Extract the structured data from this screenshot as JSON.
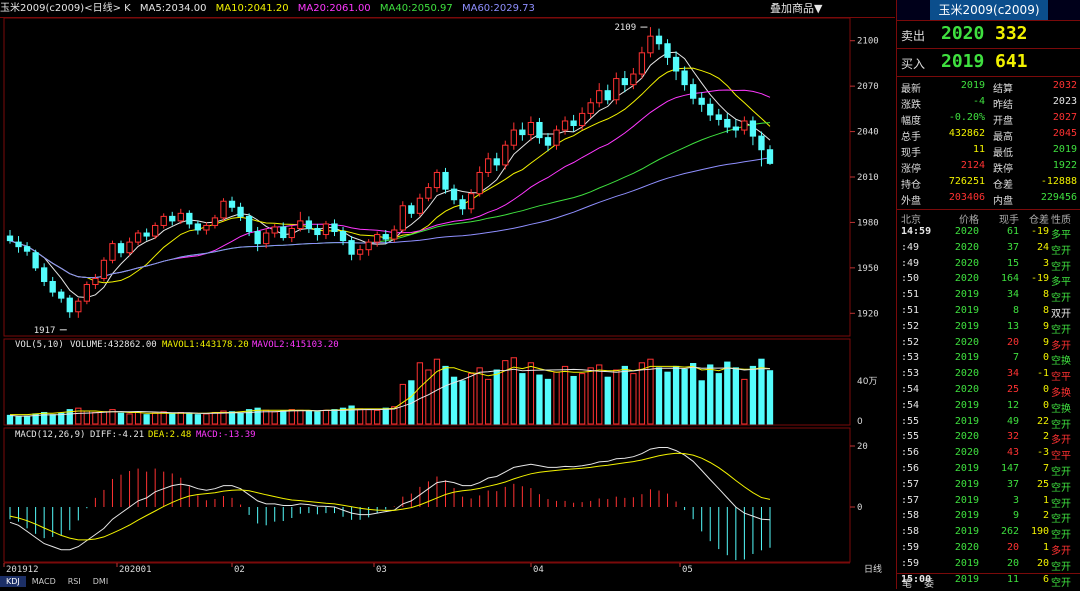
{
  "header": {
    "title": "玉米2009(c2009)<日线> K",
    "ma5": "MA5:2034.00",
    "ma10": "MA10:2041.20",
    "ma20": "MA20:2061.00",
    "ma40": "MA40:2050.97",
    "ma60": "MA60:2029.73",
    "add_label": "叠加商品▼"
  },
  "vol_header": {
    "label": "VOL(5,10)",
    "volume": "VOLUME:432862.00",
    "mavol1": "MAVOL1:443178.20",
    "mavol2": "MAVOL2:415103.20"
  },
  "macd_header": {
    "label": "MACD(12,26,9)",
    "diff": "DIFF:-4.21",
    "dea": "DEA:2.48",
    "macd": "MACD:-13.39"
  },
  "indicator_tabs": [
    "KDJ",
    "MACD",
    "RSI",
    "DMI"
  ],
  "colors": {
    "up": "#ff3232",
    "down": "#54fcfc",
    "ma5": "#e6e6e6",
    "ma10": "#f2f200",
    "ma20": "#ff38ff",
    "ma40": "#3fe03f",
    "ma60": "#8f8fff",
    "grid": "#7a0a0a"
  },
  "chart_data": {
    "type": "candlestick",
    "price_axis": {
      "ticks": [
        1920,
        1950,
        1980,
        2010,
        2040,
        2070,
        2100
      ],
      "range": [
        1905,
        2115
      ]
    },
    "annotations": [
      {
        "text": "2109",
        "value": 2109
      },
      {
        "text": "1917",
        "value": 1917
      }
    ],
    "date_labels": [
      "201912",
      "202001",
      "02",
      "03",
      "04",
      "05"
    ],
    "period_label": "日线",
    "volume_axis": {
      "ticks": [
        "40万",
        "0"
      ]
    },
    "macd_axis": {
      "ticks": [
        20,
        0
      ]
    },
    "candles": [
      [
        1971,
        1968,
        1975,
        1966
      ],
      [
        1967,
        1964,
        1971,
        1960
      ],
      [
        1964,
        1961,
        1967,
        1958
      ],
      [
        1960,
        1950,
        1962,
        1948
      ],
      [
        1950,
        1941,
        1953,
        1938
      ],
      [
        1941,
        1934,
        1944,
        1931
      ],
      [
        1934,
        1930,
        1936,
        1927
      ],
      [
        1930,
        1921,
        1932,
        1917
      ],
      [
        1921,
        1928,
        1930,
        1917
      ],
      [
        1928,
        1939,
        1941,
        1926
      ],
      [
        1939,
        1943,
        1946,
        1936
      ],
      [
        1943,
        1955,
        1957,
        1941
      ],
      [
        1955,
        1966,
        1968,
        1953
      ],
      [
        1966,
        1960,
        1968,
        1957
      ],
      [
        1960,
        1967,
        1970,
        1958
      ],
      [
        1967,
        1973,
        1975,
        1965
      ],
      [
        1973,
        1971,
        1976,
        1968
      ],
      [
        1971,
        1978,
        1980,
        1969
      ],
      [
        1978,
        1984,
        1986,
        1976
      ],
      [
        1984,
        1981,
        1987,
        1978
      ],
      [
        1981,
        1986,
        1989,
        1979
      ],
      [
        1986,
        1979,
        1988,
        1976
      ],
      [
        1979,
        1975,
        1981,
        1972
      ],
      [
        1975,
        1978,
        1980,
        1972
      ],
      [
        1978,
        1983,
        1985,
        1976
      ],
      [
        1983,
        1994,
        1996,
        1981
      ],
      [
        1994,
        1990,
        1997,
        1987
      ],
      [
        1990,
        1984,
        1993,
        1981
      ],
      [
        1984,
        1974,
        1986,
        1971
      ],
      [
        1974,
        1966,
        1977,
        1961
      ],
      [
        1966,
        1973,
        1976,
        1963
      ],
      [
        1973,
        1977,
        1979,
        1970
      ],
      [
        1977,
        1970,
        1980,
        1968
      ],
      [
        1970,
        1976,
        1978,
        1967
      ],
      [
        1976,
        1981,
        1987,
        1974
      ],
      [
        1981,
        1976,
        1984,
        1973
      ],
      [
        1976,
        1972,
        1979,
        1968
      ],
      [
        1972,
        1979,
        1981,
        1969
      ],
      [
        1979,
        1974,
        1982,
        1971
      ],
      [
        1974,
        1968,
        1977,
        1965
      ],
      [
        1968,
        1959,
        1971,
        1955
      ],
      [
        1959,
        1962,
        1965,
        1955
      ],
      [
        1962,
        1967,
        1969,
        1958
      ],
      [
        1967,
        1972,
        1974,
        1964
      ],
      [
        1972,
        1969,
        1975,
        1966
      ],
      [
        1969,
        1975,
        1978,
        1967
      ],
      [
        1975,
        1991,
        1994,
        1973
      ],
      [
        1991,
        1986,
        1993,
        1983
      ],
      [
        1986,
        1996,
        1999,
        1984
      ],
      [
        1996,
        2003,
        2006,
        1994
      ],
      [
        2003,
        2013,
        2015,
        2000
      ],
      [
        2013,
        2002,
        2016,
        1999
      ],
      [
        2002,
        1995,
        2005,
        1992
      ],
      [
        1995,
        1989,
        1998,
        1985
      ],
      [
        1989,
        1999,
        2002,
        1986
      ],
      [
        1999,
        2013,
        2017,
        1997
      ],
      [
        2013,
        2022,
        2026,
        2010
      ],
      [
        2022,
        2018,
        2026,
        2014
      ],
      [
        2018,
        2031,
        2034,
        2015
      ],
      [
        2031,
        2041,
        2046,
        2028
      ],
      [
        2041,
        2038,
        2046,
        2034
      ],
      [
        2038,
        2046,
        2050,
        2034
      ],
      [
        2046,
        2036,
        2049,
        2032
      ],
      [
        2036,
        2031,
        2039,
        2027
      ],
      [
        2031,
        2041,
        2044,
        2028
      ],
      [
        2041,
        2047,
        2050,
        2038
      ],
      [
        2047,
        2044,
        2051,
        2040
      ],
      [
        2044,
        2052,
        2056,
        2041
      ],
      [
        2052,
        2059,
        2062,
        2049
      ],
      [
        2059,
        2067,
        2072,
        2056
      ],
      [
        2067,
        2061,
        2071,
        2058
      ],
      [
        2061,
        2075,
        2079,
        2058
      ],
      [
        2075,
        2071,
        2080,
        2066
      ],
      [
        2071,
        2078,
        2082,
        2068
      ],
      [
        2078,
        2092,
        2096,
        2075
      ],
      [
        2092,
        2103,
        2109,
        2089
      ],
      [
        2103,
        2098,
        2108,
        2094
      ],
      [
        2098,
        2089,
        2101,
        2084
      ],
      [
        2089,
        2080,
        2093,
        2074
      ],
      [
        2080,
        2071,
        2083,
        2067
      ],
      [
        2071,
        2062,
        2075,
        2058
      ],
      [
        2062,
        2058,
        2066,
        2053
      ],
      [
        2058,
        2051,
        2062,
        2047
      ],
      [
        2051,
        2048,
        2055,
        2044
      ],
      [
        2048,
        2043,
        2052,
        2039
      ],
      [
        2043,
        2041,
        2048,
        2036
      ],
      [
        2041,
        2047,
        2050,
        2038
      ],
      [
        2047,
        2037,
        2050,
        2031
      ],
      [
        2037,
        2028,
        2040,
        2017
      ],
      [
        2028,
        2019,
        2031,
        2018
      ]
    ],
    "volume_levels": [
      0.12,
      0.1,
      0.11,
      0.14,
      0.16,
      0.13,
      0.15,
      0.2,
      0.22,
      0.18,
      0.16,
      0.17,
      0.2,
      0.15,
      0.14,
      0.16,
      0.13,
      0.15,
      0.17,
      0.14,
      0.16,
      0.15,
      0.13,
      0.14,
      0.16,
      0.18,
      0.17,
      0.15,
      0.2,
      0.22,
      0.19,
      0.17,
      0.18,
      0.2,
      0.19,
      0.18,
      0.17,
      0.19,
      0.2,
      0.22,
      0.25,
      0.21,
      0.2,
      0.19,
      0.22,
      0.24,
      0.55,
      0.6,
      0.85,
      0.75,
      0.9,
      0.8,
      0.65,
      0.6,
      0.7,
      0.78,
      0.62,
      0.75,
      0.88,
      0.92,
      0.7,
      0.85,
      0.68,
      0.62,
      0.72,
      0.8,
      0.66,
      0.7,
      0.78,
      0.82,
      0.65,
      0.75,
      0.8,
      0.7,
      0.85,
      0.9,
      0.78,
      0.72,
      0.8,
      0.76,
      0.84,
      0.6,
      0.82,
      0.7,
      0.86,
      0.78,
      0.62,
      0.8,
      0.9,
      0.74
    ],
    "mavol1": [
      0.13,
      0.13,
      0.13,
      0.14,
      0.15,
      0.15,
      0.16,
      0.17,
      0.18,
      0.18,
      0.18,
      0.17,
      0.17,
      0.17,
      0.16,
      0.16,
      0.15,
      0.15,
      0.15,
      0.15,
      0.15,
      0.15,
      0.15,
      0.15,
      0.16,
      0.16,
      0.16,
      0.17,
      0.18,
      0.19,
      0.19,
      0.19,
      0.19,
      0.19,
      0.19,
      0.19,
      0.18,
      0.19,
      0.19,
      0.2,
      0.21,
      0.21,
      0.21,
      0.21,
      0.21,
      0.22,
      0.3,
      0.38,
      0.51,
      0.62,
      0.73,
      0.78,
      0.78,
      0.74,
      0.71,
      0.7,
      0.67,
      0.69,
      0.74,
      0.79,
      0.77,
      0.8,
      0.77,
      0.74,
      0.72,
      0.73,
      0.72,
      0.72,
      0.73,
      0.75,
      0.74,
      0.74,
      0.76,
      0.74,
      0.76,
      0.8,
      0.8,
      0.8,
      0.8,
      0.79,
      0.8,
      0.75,
      0.76,
      0.74,
      0.78,
      0.77,
      0.76,
      0.76,
      0.78,
      0.77
    ],
    "macd_diff": [
      -5,
      -6,
      -8,
      -10,
      -12,
      -13,
      -14,
      -14,
      -13,
      -11,
      -9,
      -7,
      -4,
      -2,
      0,
      2,
      3,
      5,
      6,
      7,
      7.5,
      7,
      6,
      5.5,
      6,
      7,
      7,
      6,
      4,
      2,
      1,
      1,
      0.5,
      0.5,
      1,
      0.8,
      0.3,
      0.2,
      0,
      -1,
      -2,
      -2.5,
      -2.5,
      -2,
      -1.5,
      -1,
      1,
      2,
      4,
      6,
      8,
      8.5,
      8,
      7,
      7,
      8,
      9.5,
      10,
      11.5,
      13,
      13.5,
      14,
      13.5,
      13,
      13,
      13.3,
      13.2,
      13.5,
      14,
      14.8,
      15,
      15.8,
      16,
      16.5,
      17.5,
      19,
      19.5,
      19.5,
      18.5,
      17,
      15,
      12,
      9,
      6,
      3,
      0,
      -2,
      -3,
      -4,
      -4.2
    ],
    "macd_dea": [
      -3,
      -3.6,
      -4.5,
      -5.6,
      -6.9,
      -8.1,
      -9.3,
      -10.2,
      -10.8,
      -10.8,
      -10.5,
      -9.8,
      -8.6,
      -7.3,
      -5.9,
      -4.3,
      -2.8,
      -1.3,
      0.2,
      1.5,
      2.7,
      3.6,
      4.1,
      4.4,
      4.7,
      5.2,
      5.5,
      5.6,
      5.3,
      4.7,
      4,
      3.4,
      2.8,
      2.3,
      2.1,
      1.8,
      1.5,
      1.2,
      1,
      0.6,
      0.1,
      -0.4,
      -0.8,
      -1,
      -1.1,
      -1.1,
      -0.7,
      -0.2,
      0.7,
      1.8,
      3,
      4.1,
      4.9,
      5.3,
      5.6,
      6.1,
      6.8,
      7.4,
      8.2,
      9.2,
      10.1,
      10.9,
      11.4,
      11.7,
      12,
      12.3,
      12.5,
      12.7,
      13,
      13.4,
      13.7,
      14.1,
      14.5,
      14.9,
      15.4,
      16.1,
      16.8,
      17.3,
      17.6,
      17.5,
      17,
      16,
      14.6,
      12.9,
      10.9,
      8.7,
      6.6,
      4.7,
      3.1,
      2.48
    ]
  },
  "panel": {
    "title": "玉米2009(c2009)",
    "sell_label": "卖出",
    "sell_price": "2020",
    "sell_vol": "332",
    "buy_label": "买入",
    "buy_price": "2019",
    "buy_vol": "641",
    "stats": [
      {
        "k1": "最新",
        "v1": "2019",
        "c1": "#3fe03f",
        "k2": "结算",
        "v2": "2032",
        "c2": "#ff3232"
      },
      {
        "k1": "涨跌",
        "v1": "-4",
        "c1": "#3fe03f",
        "k2": "昨结",
        "v2": "2023",
        "c2": "#e6e6e6"
      },
      {
        "k1": "幅度",
        "v1": "-0.20%",
        "c1": "#3fe03f",
        "k2": "开盘",
        "v2": "2027",
        "c2": "#ff3232"
      },
      {
        "k1": "总手",
        "v1": "432862",
        "c1": "#f2f200",
        "k2": "最高",
        "v2": "2045",
        "c2": "#ff3232"
      },
      {
        "k1": "现手",
        "v1": "11",
        "c1": "#f2f200",
        "k2": "最低",
        "v2": "2019",
        "c2": "#3fe03f"
      },
      {
        "k1": "涨停",
        "v1": "2124",
        "c1": "#ff3232",
        "k2": "跌停",
        "v2": "1922",
        "c2": "#3fe03f"
      },
      {
        "k1": "持仓",
        "v1": "726251",
        "c1": "#f2f200",
        "k2": "仓差",
        "v2": "-12888",
        "c2": "#f2f200"
      },
      {
        "k1": "外盘",
        "v1": "203406",
        "c1": "#ff3232",
        "k2": "内盘",
        "v2": "229456",
        "c2": "#3fe03f"
      }
    ],
    "tick_headers": [
      "北京",
      "价格",
      "现手",
      "仓差",
      "性质"
    ],
    "ticks": [
      {
        "t": "14:59",
        "p": "2020",
        "pc": "#3fe03f",
        "v": "61",
        "vc": "#3fe03f",
        "d": "-19",
        "n": "多平",
        "nc": "#3fe03f"
      },
      {
        "t": ":49",
        "p": "2020",
        "pc": "#3fe03f",
        "v": "37",
        "vc": "#3fe03f",
        "d": "24",
        "n": "空开",
        "nc": "#3fe03f"
      },
      {
        "t": ":49",
        "p": "2020",
        "pc": "#3fe03f",
        "v": "15",
        "vc": "#3fe03f",
        "d": "3",
        "n": "空开",
        "nc": "#3fe03f"
      },
      {
        "t": ":50",
        "p": "2020",
        "pc": "#3fe03f",
        "v": "164",
        "vc": "#3fe03f",
        "d": "-19",
        "n": "多平",
        "nc": "#3fe03f"
      },
      {
        "t": ":51",
        "p": "2019",
        "pc": "#3fe03f",
        "v": "34",
        "vc": "#3fe03f",
        "d": "8",
        "n": "空开",
        "nc": "#3fe03f"
      },
      {
        "t": ":51",
        "p": "2019",
        "pc": "#3fe03f",
        "v": "8",
        "vc": "#3fe03f",
        "d": "8",
        "n": "双开",
        "nc": "#e6e6e6"
      },
      {
        "t": ":52",
        "p": "2019",
        "pc": "#3fe03f",
        "v": "13",
        "vc": "#3fe03f",
        "d": "9",
        "n": "空开",
        "nc": "#3fe03f"
      },
      {
        "t": ":52",
        "p": "2020",
        "pc": "#3fe03f",
        "v": "20",
        "vc": "#ff3232",
        "d": "9",
        "n": "多开",
        "nc": "#ff3232"
      },
      {
        "t": ":53",
        "p": "2019",
        "pc": "#3fe03f",
        "v": "7",
        "vc": "#3fe03f",
        "d": "0",
        "n": "空换",
        "nc": "#3fe03f"
      },
      {
        "t": ":53",
        "p": "2020",
        "pc": "#3fe03f",
        "v": "34",
        "vc": "#ff3232",
        "d": "-1",
        "n": "空平",
        "nc": "#ff3232"
      },
      {
        "t": ":54",
        "p": "2020",
        "pc": "#3fe03f",
        "v": "25",
        "vc": "#ff3232",
        "d": "0",
        "n": "多换",
        "nc": "#ff3232"
      },
      {
        "t": ":54",
        "p": "2019",
        "pc": "#3fe03f",
        "v": "12",
        "vc": "#3fe03f",
        "d": "0",
        "n": "空换",
        "nc": "#3fe03f"
      },
      {
        "t": ":55",
        "p": "2019",
        "pc": "#3fe03f",
        "v": "49",
        "vc": "#3fe03f",
        "d": "22",
        "n": "空开",
        "nc": "#3fe03f"
      },
      {
        "t": ":55",
        "p": "2020",
        "pc": "#3fe03f",
        "v": "32",
        "vc": "#ff3232",
        "d": "2",
        "n": "多开",
        "nc": "#ff3232"
      },
      {
        "t": ":56",
        "p": "2020",
        "pc": "#3fe03f",
        "v": "43",
        "vc": "#ff3232",
        "d": "-3",
        "n": "空平",
        "nc": "#ff3232"
      },
      {
        "t": ":56",
        "p": "2019",
        "pc": "#3fe03f",
        "v": "147",
        "vc": "#3fe03f",
        "d": "7",
        "n": "空开",
        "nc": "#3fe03f"
      },
      {
        "t": ":57",
        "p": "2019",
        "pc": "#3fe03f",
        "v": "37",
        "vc": "#3fe03f",
        "d": "25",
        "n": "空开",
        "nc": "#3fe03f"
      },
      {
        "t": ":57",
        "p": "2019",
        "pc": "#3fe03f",
        "v": "3",
        "vc": "#3fe03f",
        "d": "1",
        "n": "空开",
        "nc": "#3fe03f"
      },
      {
        "t": ":58",
        "p": "2019",
        "pc": "#3fe03f",
        "v": "9",
        "vc": "#3fe03f",
        "d": "2",
        "n": "空开",
        "nc": "#3fe03f"
      },
      {
        "t": ":58",
        "p": "2019",
        "pc": "#3fe03f",
        "v": "262",
        "vc": "#3fe03f",
        "d": "190",
        "n": "空开",
        "nc": "#3fe03f"
      },
      {
        "t": ":59",
        "p": "2020",
        "pc": "#3fe03f",
        "v": "20",
        "vc": "#ff3232",
        "d": "1",
        "n": "多开",
        "nc": "#ff3232"
      },
      {
        "t": ":59",
        "p": "2019",
        "pc": "#3fe03f",
        "v": "20",
        "vc": "#3fe03f",
        "d": "20",
        "n": "空开",
        "nc": "#3fe03f"
      },
      {
        "t": "15:00",
        "p": "2019",
        "pc": "#3fe03f",
        "v": "11",
        "vc": "#3fe03f",
        "d": "6",
        "n": "空开",
        "nc": "#3fe03f"
      }
    ],
    "bottom_tabs": [
      "笔",
      "委"
    ]
  }
}
